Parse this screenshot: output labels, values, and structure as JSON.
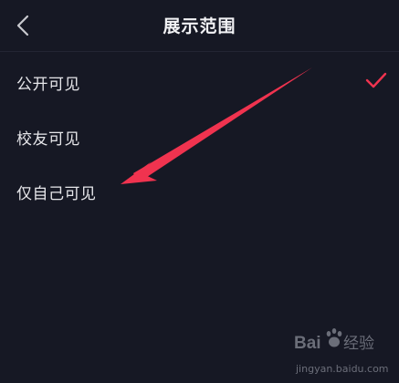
{
  "header": {
    "title": "展示范围",
    "back_icon": "chevron-left-icon"
  },
  "options": [
    {
      "label": "公开可见",
      "selected": true
    },
    {
      "label": "校友可见",
      "selected": false
    },
    {
      "label": "仅自己可见",
      "selected": false
    }
  ],
  "annotation": {
    "icon": "red-arrow-icon",
    "color": "#f0334f"
  },
  "watermark": {
    "brand": "Baidu经验",
    "url": "jingyan.baidu.com"
  },
  "colors": {
    "background": "#161824",
    "accent": "#f0334f",
    "text": "#e6e6ea"
  }
}
